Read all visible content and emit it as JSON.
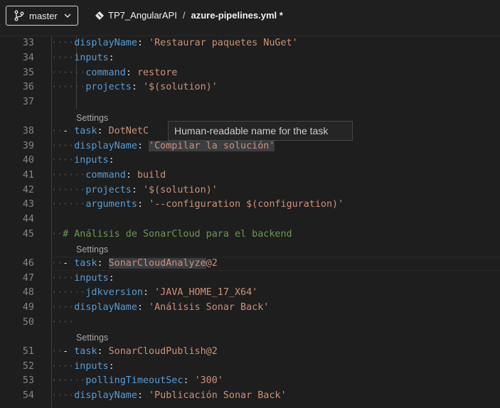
{
  "header": {
    "branch_label": "master",
    "repo_name": "TP7_AngularAPI",
    "separator": "/",
    "file_name": "azure-pipelines.yml *"
  },
  "tooltip": {
    "text": "Human-readable name for the task"
  },
  "codelens": {
    "settings_label": "Settings"
  },
  "lines": [
    {
      "num": "33",
      "code": "displayName: 'Restaurar paquetes NuGet'"
    },
    {
      "num": "34",
      "code": "inputs:"
    },
    {
      "num": "35",
      "code": "command: restore"
    },
    {
      "num": "36",
      "code": "projects: '$(solution)'"
    },
    {
      "num": "37",
      "code": ""
    },
    {
      "num": "38",
      "code": "- task: DotNetC"
    },
    {
      "num": "39",
      "code": "displayName: 'Compilar la solución'"
    },
    {
      "num": "40",
      "code": "inputs:"
    },
    {
      "num": "41",
      "code": "command: build"
    },
    {
      "num": "42",
      "code": "projects: '$(solution)'"
    },
    {
      "num": "43",
      "code": "arguments: '--configuration $(configuration)'"
    },
    {
      "num": "44",
      "code": ""
    },
    {
      "num": "45",
      "code": "# Análisis de SonarCloud para el backend"
    },
    {
      "num": "46",
      "code": "- task: SonarCloudAnalyze@2"
    },
    {
      "num": "47",
      "code": "inputs:"
    },
    {
      "num": "48",
      "code": "jdkversion: 'JAVA_HOME_17_X64'"
    },
    {
      "num": "49",
      "code": "displayName: 'Análisis Sonar Back'"
    },
    {
      "num": "50",
      "code": ""
    },
    {
      "num": "51",
      "code": "- task: SonarCloudPublish@2"
    },
    {
      "num": "52",
      "code": "inputs:"
    },
    {
      "num": "53",
      "code": "pollingTimeoutSec: '300'"
    },
    {
      "num": "54",
      "code": "displayName: 'Publicación Sonar Back'"
    }
  ]
}
